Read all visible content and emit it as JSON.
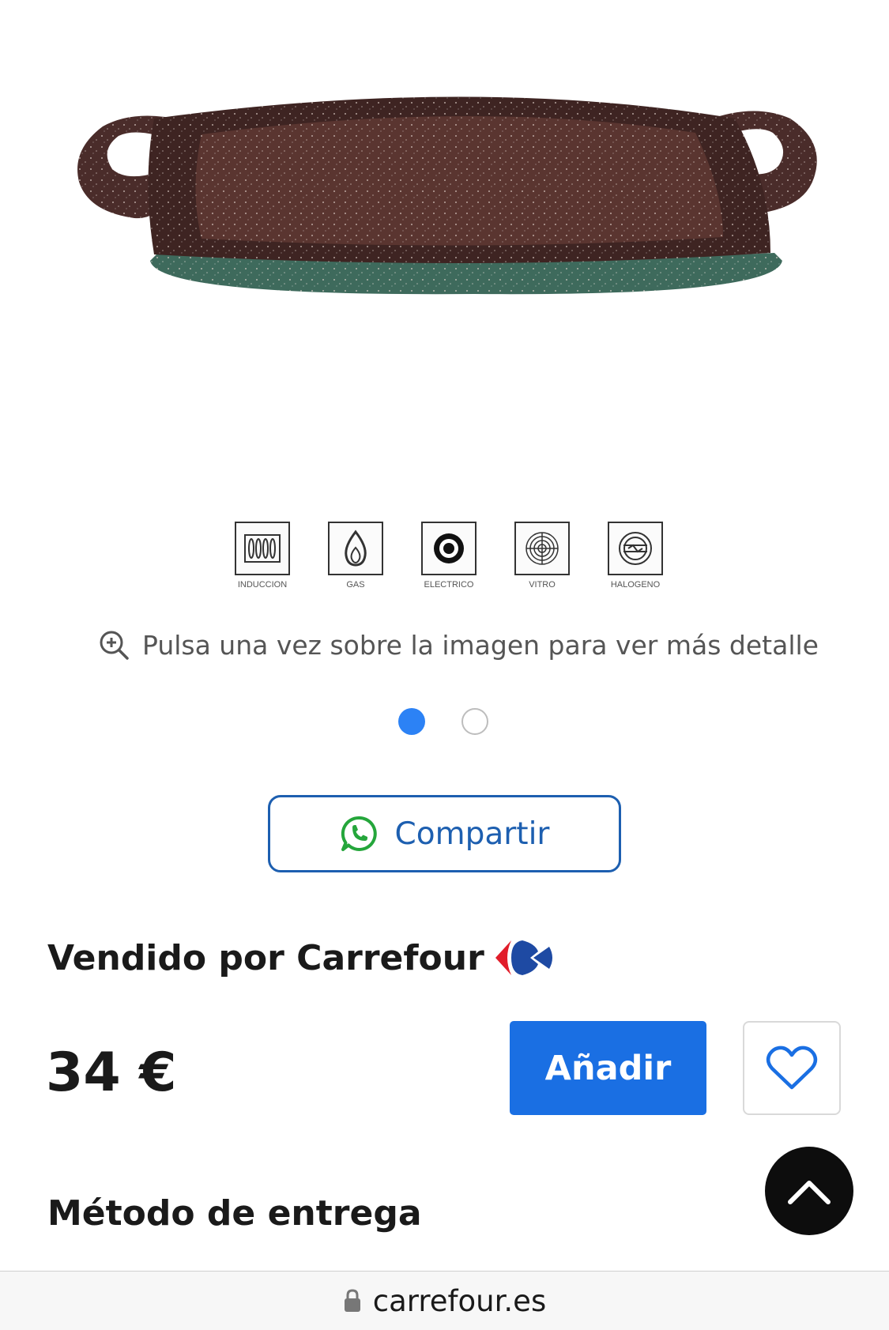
{
  "product": {
    "image_alt": "Plancha asador con asas, antiadherente efecto piedra",
    "cooking_icons": [
      {
        "name": "induction",
        "label": "INDUCCION"
      },
      {
        "name": "gas",
        "label": "GAS"
      },
      {
        "name": "electric",
        "label": "ELECTRICO"
      },
      {
        "name": "vitro",
        "label": "VITRO"
      },
      {
        "name": "halogen",
        "label": "HALOGENO"
      }
    ]
  },
  "gallery": {
    "zoom_hint": "Pulsa una vez sobre la imagen para ver más detalle",
    "slide_count": 2,
    "active_slide": 1
  },
  "share": {
    "label": "Compartir",
    "icon": "whatsapp-icon"
  },
  "seller": {
    "label": "Vendido por Carrefour",
    "logo": "carrefour-logo"
  },
  "purchase": {
    "price": "34 €",
    "add_label": "Añadir",
    "favorite_icon": "heart-icon"
  },
  "delivery": {
    "title": "Método de entrega"
  },
  "browser": {
    "url": "carrefour.es",
    "lock_icon": "lock-icon"
  },
  "colors": {
    "primary": "#1a6fe3",
    "share_border": "#1d5fb0",
    "whatsapp": "#25a63b",
    "dot_active": "#2c82f5"
  }
}
